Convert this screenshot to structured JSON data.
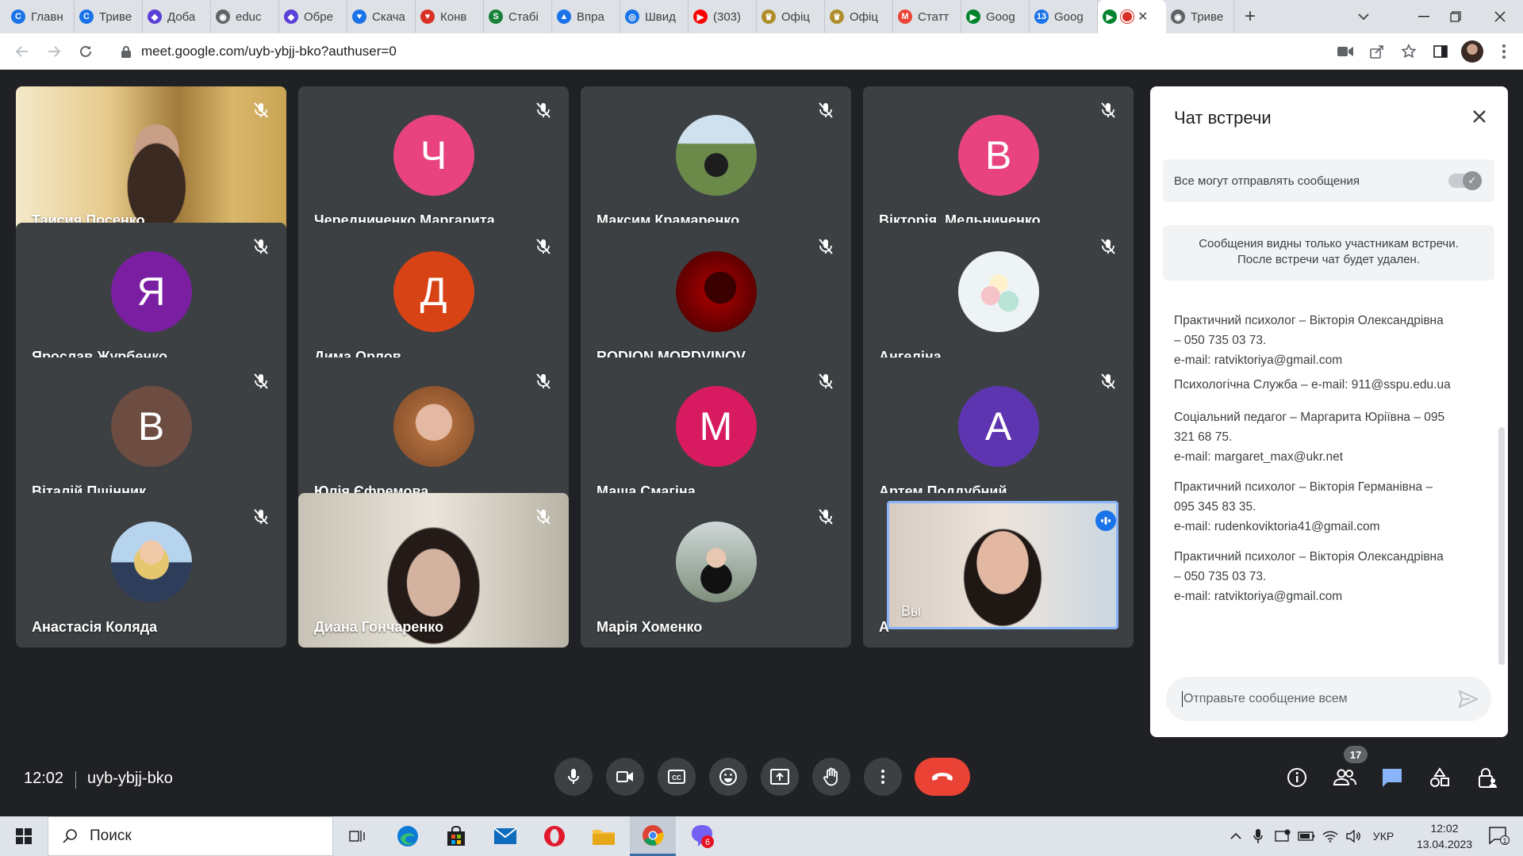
{
  "browser": {
    "tabs": [
      {
        "title": "Главн",
        "icon": "chrome-icon",
        "color": "#1a73e8"
      },
      {
        "title": "Триве",
        "icon": "chrome-icon",
        "color": "#1a73e8"
      },
      {
        "title": "Доба",
        "icon": "shield-icon",
        "color": "#5b3fd6"
      },
      {
        "title": "educ",
        "icon": "globe-icon",
        "color": "#5f6368"
      },
      {
        "title": "Обре",
        "icon": "shield-icon",
        "color": "#5b3fd6"
      },
      {
        "title": "Скача",
        "icon": "heart-icon",
        "color": "#1a73e8"
      },
      {
        "title": "Конв",
        "icon": "heart-icon",
        "color": "#d93025"
      },
      {
        "title": "Стабі",
        "icon": "sheet-icon",
        "color": "#188038"
      },
      {
        "title": "Впра",
        "icon": "triangle-icon",
        "color": "#1a73e8"
      },
      {
        "title": "Швид",
        "icon": "target-icon",
        "color": "#1a73e8"
      },
      {
        "title": "(303)",
        "icon": "youtube-icon",
        "color": "#ff0000"
      },
      {
        "title": "Офіц",
        "icon": "crest-icon",
        "color": "#b08d2a"
      },
      {
        "title": "Офіц",
        "icon": "crest-icon",
        "color": "#b08d2a"
      },
      {
        "title": "Статт",
        "icon": "gmail-icon",
        "color": "#ea4335"
      },
      {
        "title": "Goog",
        "icon": "meet-icon",
        "color": "#00832d"
      },
      {
        "title": "Goog",
        "icon": "calendar-icon",
        "color": "#1a73e8"
      }
    ],
    "active_tab": {
      "icon": "meet-icon"
    },
    "last_tab": {
      "title": "Триве",
      "icon": "globe-icon"
    },
    "url": "meet.google.com/uyb-ybjj-bko?authuser=0"
  },
  "meeting": {
    "participants": [
      {
        "name": "Таисия Посенко",
        "type": "video"
      },
      {
        "name": "Чередниченко Маргарита",
        "initial": "Ч",
        "color": "#e8437e"
      },
      {
        "name": "Максим Крамаренко",
        "type": "photo"
      },
      {
        "name": "Вікторія. Мельниченко",
        "initial": "В",
        "color": "#e8437e"
      },
      {
        "name": "Ярослав Журбенко",
        "initial": "Я",
        "color": "#7b1fa2"
      },
      {
        "name": "Дима Орлов",
        "initial": "Д",
        "color": "#d84315"
      },
      {
        "name": "RODION MORDVINOV",
        "type": "photo"
      },
      {
        "name": "Ангеліна",
        "type": "photo"
      },
      {
        "name": "Віталій Пшінник",
        "initial": "В",
        "color": "#6d4c41"
      },
      {
        "name": "Юлія Єфремова",
        "type": "photo"
      },
      {
        "name": "Маша Смагіна",
        "initial": "М",
        "color": "#d81b60"
      },
      {
        "name": "Артем Поддубний",
        "initial": "А",
        "color": "#5e35b1"
      },
      {
        "name": "Анастасія Коляда",
        "type": "photo"
      },
      {
        "name": "Диана Гончаренко",
        "type": "video"
      },
      {
        "name": "Марія Хоменко",
        "type": "photo"
      },
      {
        "name": "Вы",
        "type": "self"
      }
    ],
    "self_partial_name": "А"
  },
  "chat": {
    "title": "Чат встречи",
    "setting_label": "Все могут отправлять сообщения",
    "notice_line1": "Сообщения видны только участникам встречи.",
    "notice_line2": "После встречи чат будет удален.",
    "messages": [
      {
        "l1": "Практичний психолог – Вікторія Олександрівна",
        "l2": "– 050 735 03 73.",
        "l3": "e-mail: ratviktoriya@gmail.com"
      },
      {
        "l1": "Психологічна Служба – e-mail: 911@sspu.edu.ua"
      },
      {
        "l1": "Соціальний педагог – Маргарита Юріївна – 095",
        "l2": "321 68 75.",
        "l3": "e-mail: margaret_max@ukr.net"
      },
      {
        "l1": "Практичний психолог – Вікторія Германівна –",
        "l2": "095 345 83 35.",
        "l3": "e-mail: rudenkoviktoria41@gmail.com"
      },
      {
        "l1": "Практичний психолог – Вікторія Олександрівна",
        "l2": "– 050 735 03 73.",
        "l3": "e-mail: ratviktoriya@gmail.com"
      }
    ],
    "composer_placeholder": "Отправьте сообщение всем"
  },
  "bottombar": {
    "time": "12:02",
    "code": "uyb-ybjj-bko",
    "participant_count": "17"
  },
  "taskbar": {
    "search_placeholder": "Поиск",
    "viber_badge": "6",
    "language": "УКР",
    "time": "12:02",
    "date": "13.04.2023",
    "notifications": "1"
  },
  "colors": {
    "hangup": "#ea4335",
    "chat_active": "#8ab4f8",
    "accent": "#1a73e8"
  }
}
